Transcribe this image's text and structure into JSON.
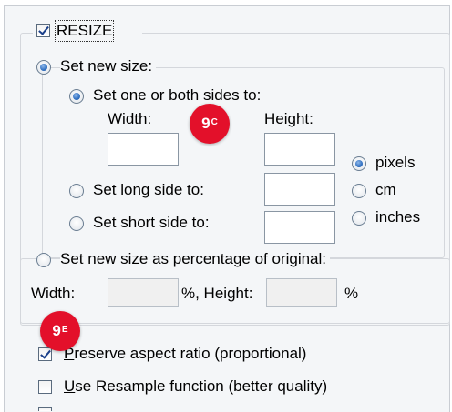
{
  "resize": {
    "checkbox_label": "RESIZE",
    "checked": true
  },
  "set_new_size": {
    "label": "Set new size:",
    "selected": true,
    "one_or_both": {
      "label": "Set one or both sides to:",
      "selected": true,
      "width_label": "Width:",
      "height_label": "Height:",
      "width_value": "",
      "height_value": ""
    },
    "long_side": {
      "label": "Set long side to:",
      "selected": false,
      "value": ""
    },
    "short_side": {
      "label": "Set short side to:",
      "selected": false,
      "value": ""
    },
    "units": [
      {
        "label": "pixels",
        "selected": true
      },
      {
        "label": "cm",
        "selected": false
      },
      {
        "label": "inches",
        "selected": false
      }
    ]
  },
  "percentage": {
    "label": "Set new size as percentage of original:",
    "selected": false,
    "width_label": "Width:",
    "width_suffix": "%, Height:",
    "height_suffix": "%",
    "width_value": "",
    "height_value": ""
  },
  "options": {
    "preserve": {
      "label_first": "P",
      "label_rest": "reserve aspect ratio (proportional)",
      "checked": true
    },
    "resample": {
      "label_first": "U",
      "label_rest": "se Resample function (better quality)",
      "checked": false
    }
  },
  "badges": {
    "top": {
      "main": "9",
      "sup": "C"
    },
    "bottom": {
      "main": "9",
      "sup": "E"
    }
  },
  "colors": {
    "badge": "#e3102a",
    "panel": "#f4f6f8",
    "radio_selected": "#2f6fc1"
  }
}
